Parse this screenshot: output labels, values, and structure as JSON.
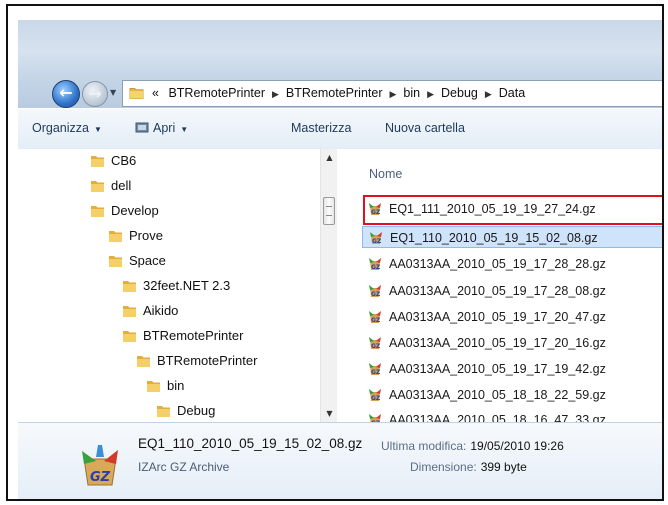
{
  "address_bar": {
    "overflow": "«",
    "crumbs": [
      "BTRemotePrinter",
      "BTRemotePrinter",
      "bin",
      "Debug",
      "Data"
    ]
  },
  "toolbar": {
    "organize": "Organizza",
    "open": "Apri",
    "burn": "Masterizza",
    "new_folder": "Nuova cartella"
  },
  "tree": {
    "items": [
      {
        "label": "CB6"
      },
      {
        "label": "dell"
      },
      {
        "label": "Develop"
      },
      {
        "label": "Prove"
      },
      {
        "label": "Space"
      },
      {
        "label": "32feet.NET 2.3"
      },
      {
        "label": "Aikido"
      },
      {
        "label": "BTRemotePrinter"
      },
      {
        "label": "BTRemotePrinter"
      },
      {
        "label": "bin"
      },
      {
        "label": "Debug"
      }
    ]
  },
  "file_list": {
    "column_header": "Nome",
    "files": [
      {
        "name": "EQ1_111_2010_05_19_19_27_24.gz",
        "highlighted": true
      },
      {
        "name": "EQ1_110_2010_05_19_15_02_08.gz",
        "selected": true
      },
      {
        "name": "AA0313AA_2010_05_19_17_28_28.gz"
      },
      {
        "name": "AA0313AA_2010_05_19_17_28_08.gz"
      },
      {
        "name": "AA0313AA_2010_05_19_17_20_47.gz"
      },
      {
        "name": "AA0313AA_2010_05_19_17_20_16.gz"
      },
      {
        "name": "AA0313AA_2010_05_19_17_19_42.gz"
      },
      {
        "name": "AA0313AA_2010_05_18_18_22_59.gz"
      },
      {
        "name": "AA0313AA_2010_05_18_16_47_33.gz"
      }
    ]
  },
  "details": {
    "file_name": "EQ1_110_2010_05_19_15_02_08.gz",
    "file_type": "IZArc GZ Archive",
    "modified_label": "Ultima modifica:",
    "modified_value": "19/05/2010 19:26",
    "size_label": "Dimensione:",
    "size_value": "399 byte"
  },
  "colors": {
    "selection": "#cfe3fb",
    "highlight_box": "#e0101e"
  }
}
